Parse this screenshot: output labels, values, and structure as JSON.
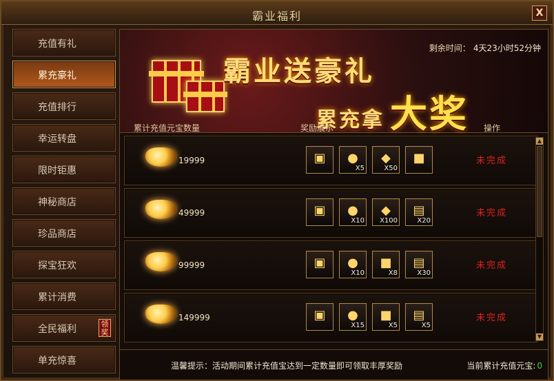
{
  "window": {
    "title": "霸业福利",
    "close_label": "X"
  },
  "sidebar": {
    "items": [
      {
        "label": "充值有礼"
      },
      {
        "label": "累充豪礼"
      },
      {
        "label": "充值排行"
      },
      {
        "label": "幸运转盘"
      },
      {
        "label": "限时钜惠"
      },
      {
        "label": "神秘商店"
      },
      {
        "label": "珍品商店"
      },
      {
        "label": "探宝狂欢"
      },
      {
        "label": "累计消费"
      },
      {
        "label": "全民福利",
        "badge": "领奖"
      },
      {
        "label": "单充惊喜"
      }
    ],
    "active_index": 1
  },
  "banner": {
    "headline_1": "霸业送豪礼",
    "headline_2_prefix": "累充拿",
    "headline_2_big": "大奖",
    "timer_label": "剩余时间：",
    "timer_value": "4天23小时52分钟"
  },
  "table": {
    "col_1": "累计充值元宝数量",
    "col_2": "奖励展示",
    "col_3": "操作"
  },
  "rows": [
    {
      "amount": "19999",
      "items": [
        {
          "icon": "gold-chest-icon",
          "qty": ""
        },
        {
          "icon": "green-bag-icon",
          "qty": "X5"
        },
        {
          "icon": "crystal-icon",
          "qty": "X50"
        },
        {
          "icon": "treasure-chest-icon",
          "qty": ""
        }
      ],
      "status": "未完成"
    },
    {
      "amount": "49999",
      "items": [
        {
          "icon": "gold-chest-icon",
          "qty": ""
        },
        {
          "icon": "green-bag-icon",
          "qty": "X10"
        },
        {
          "icon": "crystal-icon",
          "qty": "X100"
        },
        {
          "icon": "green-scroll-icon",
          "qty": "X20"
        }
      ],
      "status": "未完成"
    },
    {
      "amount": "99999",
      "items": [
        {
          "icon": "gold-chest-icon",
          "qty": ""
        },
        {
          "icon": "orange-bag-icon",
          "qty": "X10"
        },
        {
          "icon": "red-chest-icon",
          "qty": "X8"
        },
        {
          "icon": "green-scroll-icon",
          "qty": "X30"
        }
      ],
      "status": "未完成"
    },
    {
      "amount": "149999",
      "items": [
        {
          "icon": "gold-chest-icon",
          "qty": ""
        },
        {
          "icon": "green-bag-icon",
          "qty": "X15"
        },
        {
          "icon": "open-chest-icon",
          "qty": "X5"
        },
        {
          "icon": "red-scroll-icon",
          "qty": "X5"
        }
      ],
      "status": "未完成"
    }
  ],
  "footer": {
    "tip": "温馨提示：活动期间累计充值宝达到一定数量即可领取丰厚奖励",
    "total_label": "当前累计充值元宝:",
    "total_value": "0"
  },
  "scroll": {
    "up": "▲",
    "down": "▼"
  }
}
